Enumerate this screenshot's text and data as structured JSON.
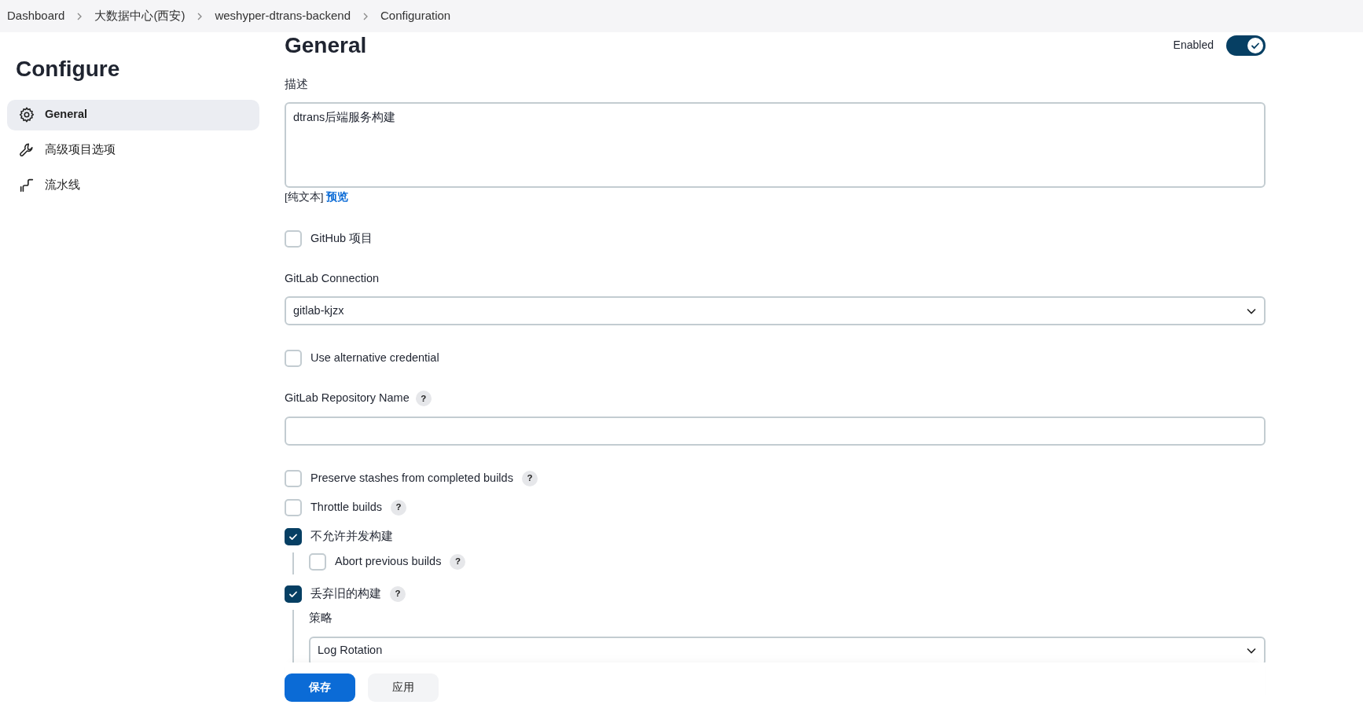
{
  "breadcrumbs": [
    {
      "label": "Dashboard"
    },
    {
      "label": "大数据中心(西安)"
    },
    {
      "label": "weshyper-dtrans-backend"
    },
    {
      "label": "Configuration"
    }
  ],
  "sidebar": {
    "title": "Configure",
    "items": [
      {
        "label": "General",
        "selected": true
      },
      {
        "label": "高级项目选项",
        "selected": false
      },
      {
        "label": "流水线",
        "selected": false
      }
    ]
  },
  "section": {
    "title": "General",
    "enabled_label": "Enabled",
    "enabled": true
  },
  "fields": [
    {
      "kind": "textarea",
      "label": "描述",
      "value": "dtrans后端服务构建",
      "hint": "[纯文本]",
      "link": "预览"
    },
    {
      "kind": "checkbox",
      "label": "GitHub 项目",
      "checked": false
    },
    {
      "kind": "select",
      "label": "GitLab Connection",
      "value": "gitlab-kjzx"
    },
    {
      "kind": "checkbox",
      "label": "Use alternative credential",
      "checked": false
    },
    {
      "kind": "text",
      "label": "GitLab Repository Name",
      "help": "?"
    },
    {
      "kind": "checkbox",
      "label": "Preserve stashes from completed builds",
      "checked": false,
      "help": "?"
    },
    {
      "kind": "checkbox",
      "label": "Throttle builds",
      "checked": false,
      "help": "?"
    },
    {
      "kind": "checkbox",
      "label": "不允许并发构建",
      "checked": true,
      "children": [
        {
          "kind": "checkbox",
          "label": "Abort previous builds",
          "checked": false,
          "help": "?"
        }
      ]
    },
    {
      "kind": "checkbox",
      "label": "丢弃旧的构建",
      "checked": true,
      "help": "?",
      "children": [
        {
          "kind": "select",
          "label": "策略",
          "value": "Log Rotation"
        }
      ]
    }
  ],
  "buttons": [
    {
      "label": "保存",
      "kind": "primary"
    },
    {
      "label": "应用",
      "kind": "secondary"
    }
  ]
}
